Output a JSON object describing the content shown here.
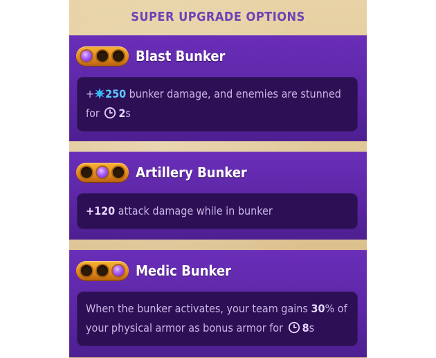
{
  "header": {
    "title": "SUPER UPGRADE OPTIONS"
  },
  "colors": {
    "panel_purple": "#5c26a5",
    "desc_bg": "#2c0f54",
    "gold": "#e2891a",
    "gem_purple": "#b46bff",
    "accent_blue": "#5cc8ff",
    "header_text": "#6d42b6"
  },
  "options": [
    {
      "title": "Blast Bunker",
      "tier_active": 1,
      "desc": {
        "plus": "+",
        "icon": "burst-icon",
        "value": "250",
        "text1": " bunker damage, and enemies are stunned for ",
        "clock_icon": "clock-icon",
        "duration": "2",
        "unit": "s"
      }
    },
    {
      "title": "Artillery Bunker",
      "tier_active": 2,
      "desc": {
        "value": "+120",
        "text1": " attack damage while in bunker"
      }
    },
    {
      "title": "Medic Bunker",
      "tier_active": 3,
      "desc": {
        "text1": "When the bunker activates, your team gains ",
        "value": "30",
        "value_unit": "%",
        "text2": " of your physical armor as bonus armor for ",
        "clock_icon": "clock-icon",
        "duration": "8",
        "unit": "s"
      }
    }
  ]
}
